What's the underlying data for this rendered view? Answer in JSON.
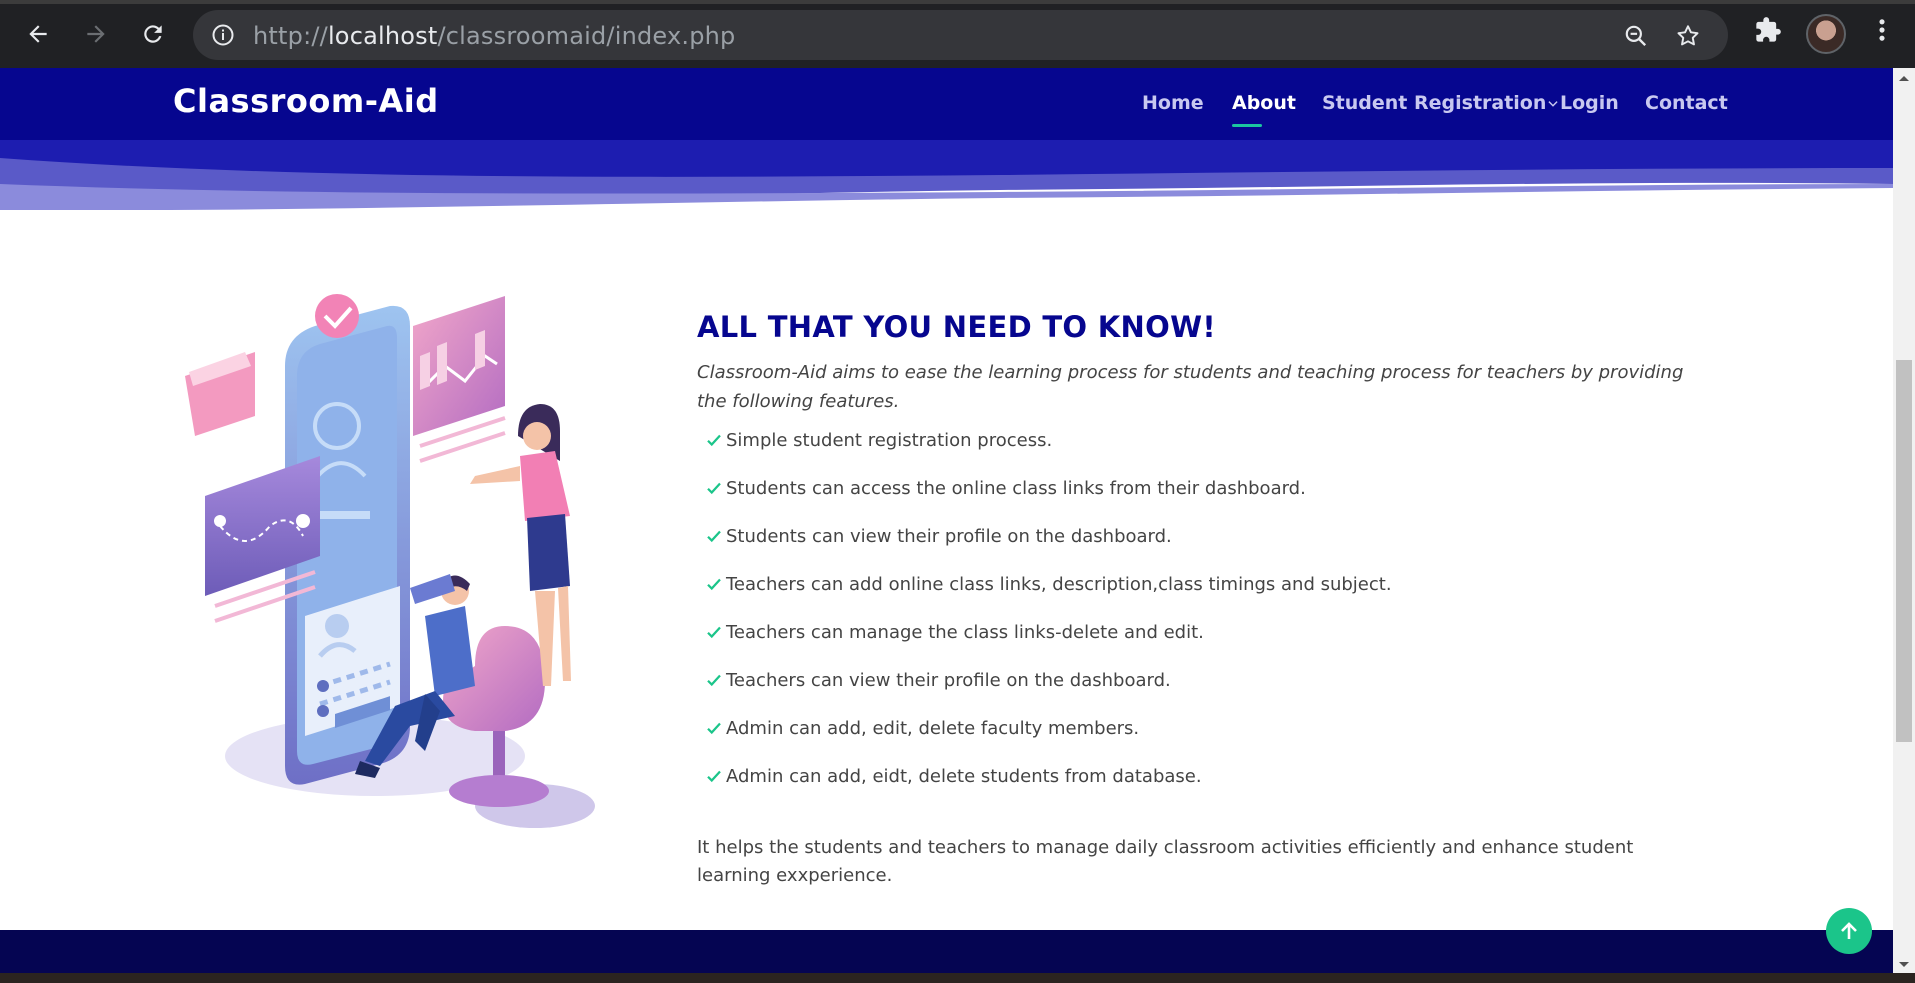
{
  "browser": {
    "url_scheme": "http://",
    "url_host": "localhost",
    "url_path": "/classroomaid/index.php"
  },
  "site": {
    "brand": "Classroom-Aid",
    "nav": [
      {
        "label": "Home"
      },
      {
        "label": "About"
      },
      {
        "label": "Student Registration"
      },
      {
        "label": "Login"
      },
      {
        "label": "Contact"
      }
    ],
    "active_nav": "About",
    "colors": {
      "primary": "#06068f",
      "accent": "#1bc5a0",
      "footer": "#050552"
    }
  },
  "about": {
    "title": "ALL THAT YOU NEED TO KNOW!",
    "intro": "Classroom-Aid aims to ease the learning process for students and teaching process for teachers by providing the following features.",
    "features": [
      "Simple student registration process.",
      "Students can access the online class links from their dashboard.",
      "Students can view their profile on the dashboard.",
      "Teachers can add online class links, description,class timings and subject.",
      "Teachers can manage the class links-delete and edit.",
      "Teachers can view their profile on the dashboard.",
      "Admin can add, edit, delete faculty members.",
      "Admin can add, eidt, delete students from database."
    ],
    "outro": "It helps the students and teachers to manage daily classroom activities efficiently and enhance student learning exxperience."
  }
}
